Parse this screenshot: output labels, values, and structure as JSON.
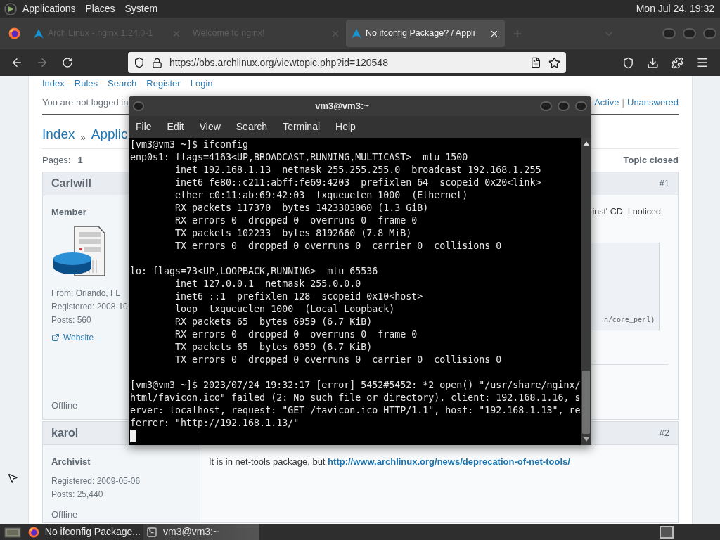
{
  "top_panel": {
    "menus": [
      "Applications",
      "Places",
      "System"
    ],
    "clock": "Mon Jul 24, 19:32"
  },
  "browser": {
    "tabs": [
      {
        "title": "Arch Linux - nginx 1.24.0-1",
        "selected": false,
        "icon": true
      },
      {
        "title": "Welcome to nginx!",
        "selected": false,
        "icon": false
      },
      {
        "title": "No ifconfig Package? / Appli",
        "selected": true,
        "icon": true
      }
    ],
    "url": "https://bbs.archlinux.org/viewtopic.php?id=120548"
  },
  "forum": {
    "nav_links": [
      "Index",
      "Rules",
      "Search",
      "Register",
      "Login"
    ],
    "login_status": "You are not logged in",
    "quick_links": [
      "Active",
      "Unanswered"
    ],
    "quick_separator": "|",
    "breadcrumb": [
      "Index",
      "Applic"
    ],
    "breadcrumb_separator": "»",
    "pages_label": "Pages:",
    "page": "1",
    "topic_status": "Topic closed",
    "posts": [
      {
        "kind": "covered",
        "author": "Carlwill",
        "number": "#1",
        "rank": "Member",
        "avatar": true,
        "details": [
          "From: Orlando, FL",
          "Registered: 2008-10",
          "Posts: 560"
        ],
        "website": "Website",
        "status": "Offline",
        "text": "inst' CD. I noticed",
        "code": "n/core_perl)"
      },
      {
        "kind": "full",
        "author": "karol",
        "number": "#2",
        "rank": "Archivist",
        "avatar": false,
        "details": [
          "Registered: 2009-05-06",
          "Posts: 25,440"
        ],
        "status": "Offline",
        "text": "It is in net-tools package, but",
        "link": "http://www.archlinux.org/news/deprecation-of-net-tools/"
      }
    ]
  },
  "terminal": {
    "title": "vm3@vm3:~",
    "menus": [
      "File",
      "Edit",
      "View",
      "Search",
      "Terminal",
      "Help"
    ],
    "blocks": [
      [
        "[vm3@vm3 ~]$ ifconfig",
        "enp0s1: flags=4163<UP,BROADCAST,RUNNING,MULTICAST>  mtu 1500",
        "        inet 192.168.1.13  netmask 255.255.255.0  broadcast 192.168.1.255",
        "        inet6 fe80::c211:abff:fe69:4203  prefixlen 64  scopeid 0x20<link>",
        "        ether c0:11:ab:69:42:03  txqueuelen 1000  (Ethernet)",
        "        RX packets 117370  bytes 1423303060 (1.3 GiB)",
        "        RX errors 0  dropped 0  overruns 0  frame 0",
        "        TX packets 102233  bytes 8192660 (7.8 MiB)",
        "        TX errors 0  dropped 0 overruns 0  carrier 0  collisions 0"
      ],
      [
        "lo: flags=73<UP,LOOPBACK,RUNNING>  mtu 65536",
        "        inet 127.0.0.1  netmask 255.0.0.0",
        "        inet6 ::1  prefixlen 128  scopeid 0x10<host>",
        "        loop  txqueuelen 1000  (Local Loopback)",
        "        RX packets 65  bytes 6959 (6.7 KiB)",
        "        RX errors 0  dropped 0  overruns 0  frame 0",
        "        TX packets 65  bytes 6959 (6.7 KiB)",
        "        TX errors 0  dropped 0 overruns 0  carrier 0  collisions 0"
      ],
      [
        "[vm3@vm3 ~]$ 2023/07/24 19:32:17 [error] 5452#5452: *2 open() \"/usr/share/nginx/",
        "html/favicon.ico\" failed (2: No such file or directory), client: 192.168.1.16, s",
        "erver: localhost, request: \"GET /favicon.ico HTTP/1.1\", host: \"192.168.1.13\", re",
        "ferrer: \"http://192.168.1.13/\""
      ]
    ]
  },
  "taskbar": {
    "items": [
      {
        "label": "No ifconfig Package...",
        "selected": false,
        "kind": "browser"
      },
      {
        "label": "vm3@vm3:~",
        "selected": true,
        "kind": "terminal"
      }
    ]
  }
}
